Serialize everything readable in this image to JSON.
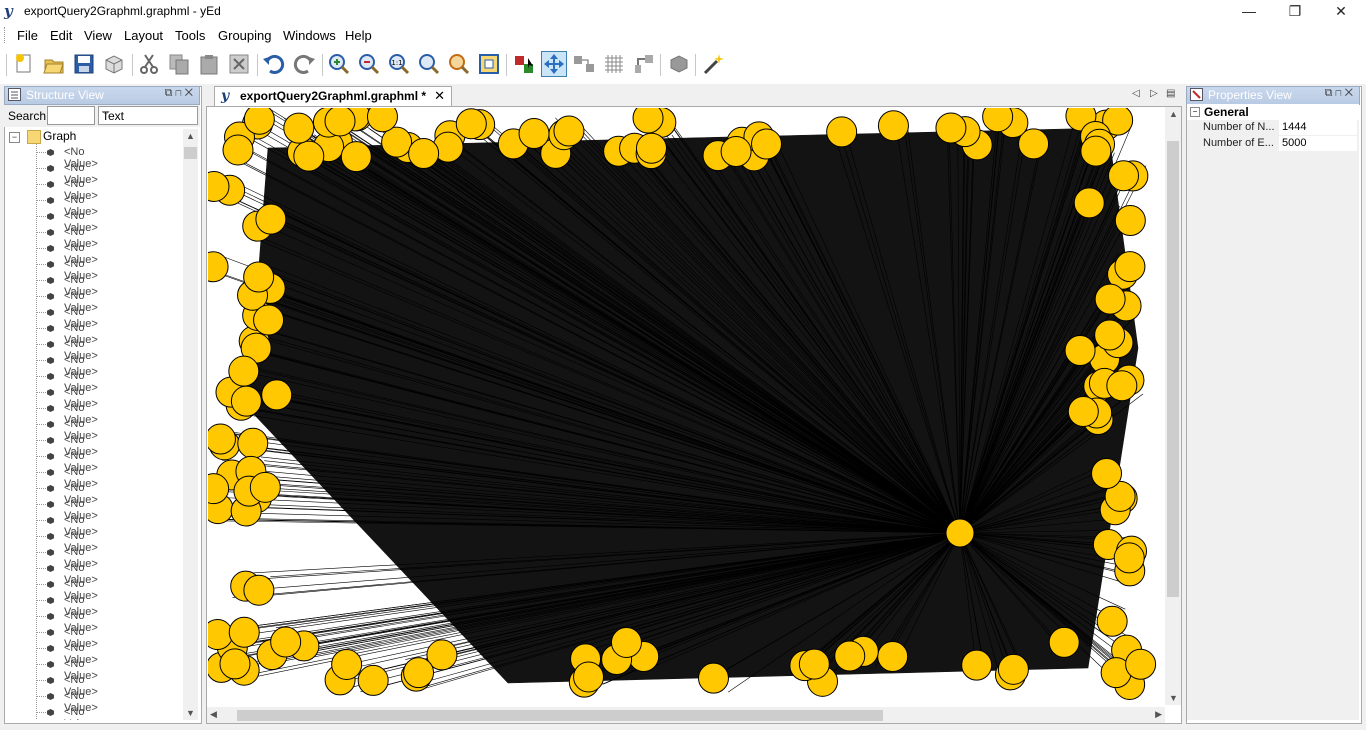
{
  "window": {
    "title": "exportQuery2Graphml.graphml - yEd",
    "controls": {
      "minimize": "—",
      "restore": "❐",
      "close": "✕"
    }
  },
  "menu": [
    "File",
    "Edit",
    "View",
    "Layout",
    "Tools",
    "Grouping",
    "Windows",
    "Help"
  ],
  "toolbar": {
    "buttons": [
      "new-document-icon",
      "open-icon",
      "save-icon",
      "export-icon",
      "cut-icon",
      "copy-icon",
      "paste-icon",
      "delete-icon",
      "undo-icon",
      "redo-icon",
      "zoom-in-icon",
      "zoom-out-icon",
      "zoom-1-1-icon",
      "zoom-fit-icon",
      "zoom-area-icon",
      "fit-content-icon",
      "edit-mode-icon",
      "navigation-mode-icon",
      "snapping-icon",
      "grid-icon",
      "orthogonal-edges-icon",
      "plugins-icon",
      "wizard-icon"
    ],
    "one_to_one_label": "1:1",
    "brand_logo": "y"
  },
  "structure_view": {
    "title": "Structure View",
    "search_label": "Search",
    "search_value": "",
    "filter_selected": "Text",
    "root_label": "Graph",
    "root_toggle": "−",
    "items": [
      "<No Value>",
      "<No Value>",
      "<No Value>",
      "<No Value>",
      "<No Value>",
      "<No Value>",
      "<No Value>",
      "<No Value>",
      "<No Value>",
      "<No Value>",
      "<No Value>",
      "<No Value>",
      "<No Value>",
      "<No Value>",
      "<No Value>",
      "<No Value>",
      "<No Value>",
      "<No Value>",
      "<No Value>",
      "<No Value>",
      "<No Value>",
      "<No Value>",
      "<No Value>",
      "<No Value>",
      "<No Value>",
      "<No Value>",
      "<No Value>",
      "<No Value>",
      "<No Value>",
      "<No Value>",
      "<No Value>",
      "<No Value>",
      "<No Value>",
      "<No Value>",
      "<No Value>",
      "<No Value>",
      "<No Value>"
    ]
  },
  "document_tab": {
    "label": "exportQuery2Graphml.graphml *",
    "close": "✕",
    "icon": "y"
  },
  "graph": {
    "node_color": "#FFC800",
    "edge_color": "#000000",
    "hub_node": "central-hub"
  },
  "properties_view": {
    "title": "Properties View",
    "group": "General",
    "group_toggle": "−",
    "rows": [
      {
        "key": "Number of N...",
        "value": "1444"
      },
      {
        "key": "Number of E...",
        "value": "5000"
      }
    ]
  }
}
